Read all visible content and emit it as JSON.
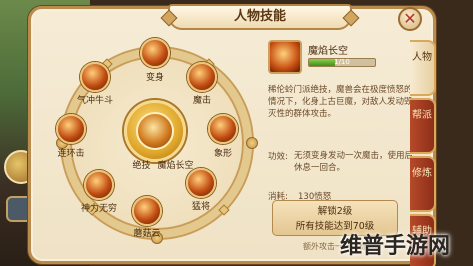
{
  "window": {
    "title": "人物技能"
  },
  "wheel": {
    "center": {
      "prefix": "绝技",
      "name": "魔焰长空"
    },
    "skills": [
      {
        "id": "bianshen",
        "label": "变身"
      },
      {
        "id": "motou",
        "label": "魔击"
      },
      {
        "id": "xiangxing",
        "label": "象形"
      },
      {
        "id": "mengshou",
        "label": "猛将"
      },
      {
        "id": "jiyu",
        "label": "蘑菇云"
      },
      {
        "id": "shenli",
        "label": "神力无穷"
      },
      {
        "id": "lianhuan",
        "label": "连环击"
      },
      {
        "id": "qichong",
        "label": "气冲牛斗"
      }
    ]
  },
  "detail": {
    "name": "魔焰长空",
    "level": "1/10",
    "level_fraction": 0.4,
    "description": "稀伦蛉门派绝技，魔兽会在极度愤怒的情况下，化身上古巨魔，对敌人发动毁灭性的群体攻击。",
    "effect_label": "功效:",
    "effect_text": "无须变身发动一次魔击，使用后休息一回合。",
    "cost_label": "消耗:",
    "cost_value": "130愤怒",
    "unlock_line1": "解锁2级",
    "unlock_line2": "所有技能达到70级",
    "extra_text": "额外攻击一个目标"
  },
  "tabs": [
    {
      "label": "人物",
      "active": true
    },
    {
      "label": "帮派",
      "active": false
    },
    {
      "label": "修炼",
      "active": false
    },
    {
      "label": "辅助",
      "active": false
    }
  ],
  "watermark": "维普手游网"
}
